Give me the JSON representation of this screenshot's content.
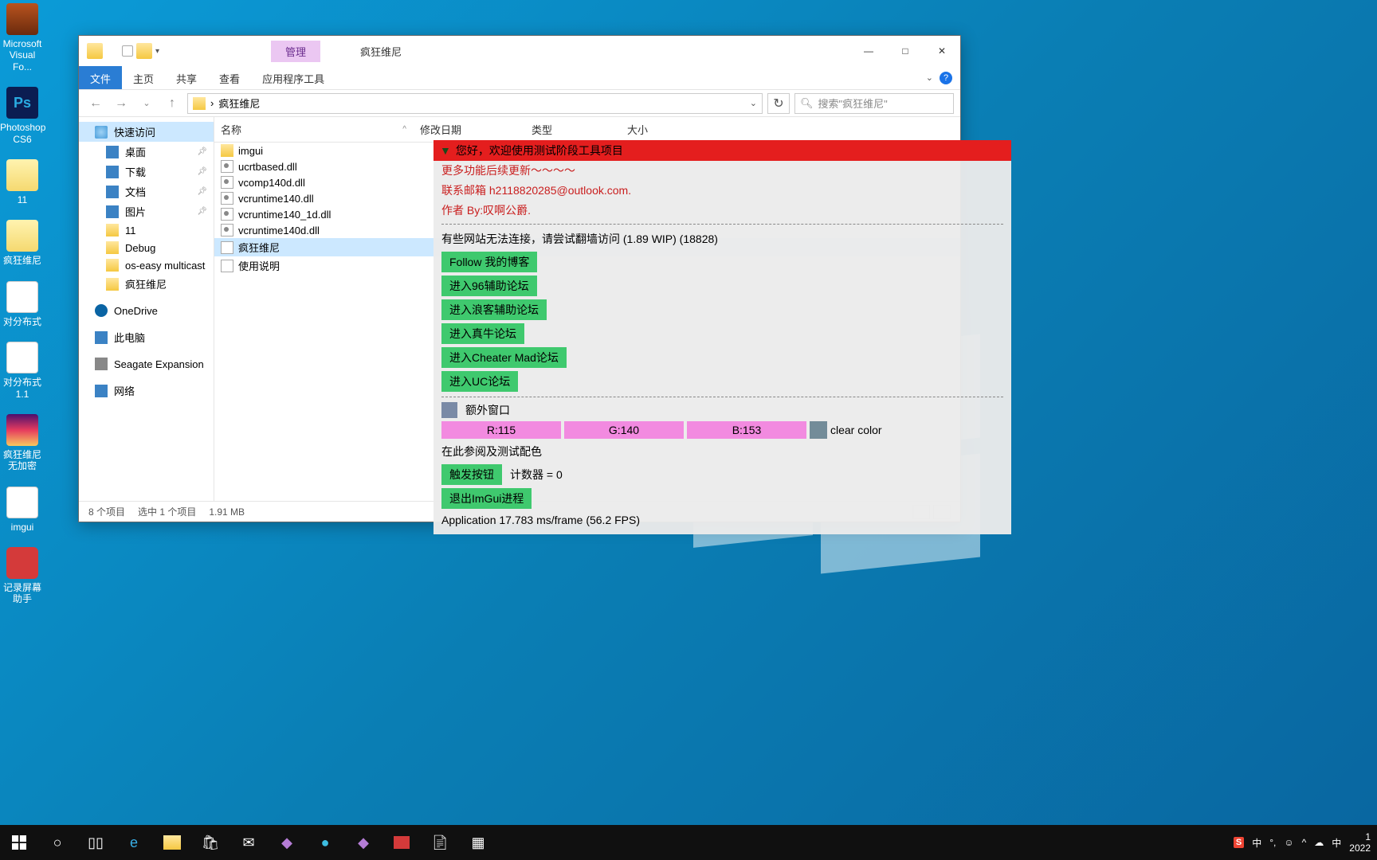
{
  "desktop": {
    "icons": [
      {
        "label": "Microsoft Visual Fo...",
        "cls": "fx"
      },
      {
        "label": "Photoshop CS6",
        "cls": "ps"
      },
      {
        "label": "11",
        "cls": "fd"
      },
      {
        "label": "疯狂维尼",
        "cls": "fd"
      },
      {
        "label": "对分布式",
        "cls": "wt"
      },
      {
        "label": "对分布式 1.1",
        "cls": "wt"
      },
      {
        "label": "疯狂维尼 无加密",
        "cls": "rar"
      },
      {
        "label": "imgui",
        "cls": "wt"
      },
      {
        "label": "记录屏幕助手",
        "cls": "rec"
      }
    ]
  },
  "explorer": {
    "manage_tab": "管理",
    "title": "疯狂维尼",
    "ribbon": {
      "file": "文件",
      "tabs": [
        "主页",
        "共享",
        "查看",
        "应用程序工具"
      ]
    },
    "addr": {
      "chev": "›",
      "path": "疯狂维尼"
    },
    "search_placeholder": "搜索\"疯狂维尼\"",
    "side": {
      "quick": "快速访问",
      "items_q": [
        "桌面",
        "下载",
        "文档",
        "图片",
        "11",
        "Debug",
        "os-easy multicast",
        "疯狂维尼"
      ],
      "onedrive": "OneDrive",
      "thispc": "此电脑",
      "seagate": "Seagate Expansion",
      "network": "网络"
    },
    "cols": {
      "name": "名称",
      "date": "修改日期",
      "type": "类型",
      "size": "大小"
    },
    "files": [
      {
        "name": "imgui",
        "cls": "fold"
      },
      {
        "name": "ucrtbased.dll",
        "cls": "dll"
      },
      {
        "name": "vcomp140d.dll",
        "cls": "dll"
      },
      {
        "name": "vcruntime140.dll",
        "cls": "dll"
      },
      {
        "name": "vcruntime140_1d.dll",
        "cls": "dll"
      },
      {
        "name": "vcruntime140d.dll",
        "cls": "dll"
      },
      {
        "name": "疯狂维尼",
        "cls": "exe",
        "sel": true
      },
      {
        "name": "使用说明",
        "cls": "txt"
      }
    ],
    "status": {
      "items": "8 个项目",
      "sel": "选中 1 个项目",
      "size": "1.91 MB"
    }
  },
  "imgui": {
    "header": "您好，欢迎使用测试阶段工具项目",
    "red1": "更多功能后续更新～～～～",
    "red2": "联系邮箱 h2118820285@outlook.com.",
    "red3": "作者 By:叹啊公爵.",
    "note": "有些网站无法连接，请尝试翻墙访问 (1.89 WIP) (18828)",
    "buttons": [
      "Follow 我的博客",
      "进入96辅助论坛",
      "进入浪客辅助论坛",
      "进入真牛论坛",
      "进入Cheater Mad论坛",
      "进入UC论坛"
    ],
    "extra_win": "额外窗口",
    "sliders": {
      "r": "R:115",
      "g": "G:140",
      "b": "B:153",
      "label": "clear color"
    },
    "test_text": "在此参阅及测试配色",
    "trig": "触发按钮",
    "counter": "计数器 = 0",
    "exit": "退出ImGui进程",
    "perf": "Application  17.783 ms/frame (56.2 FPS)"
  },
  "tray": {
    "sogou": "S",
    "zh1": "中",
    "zh2": "中",
    "clock_time": "1",
    "clock_date": "2022"
  }
}
